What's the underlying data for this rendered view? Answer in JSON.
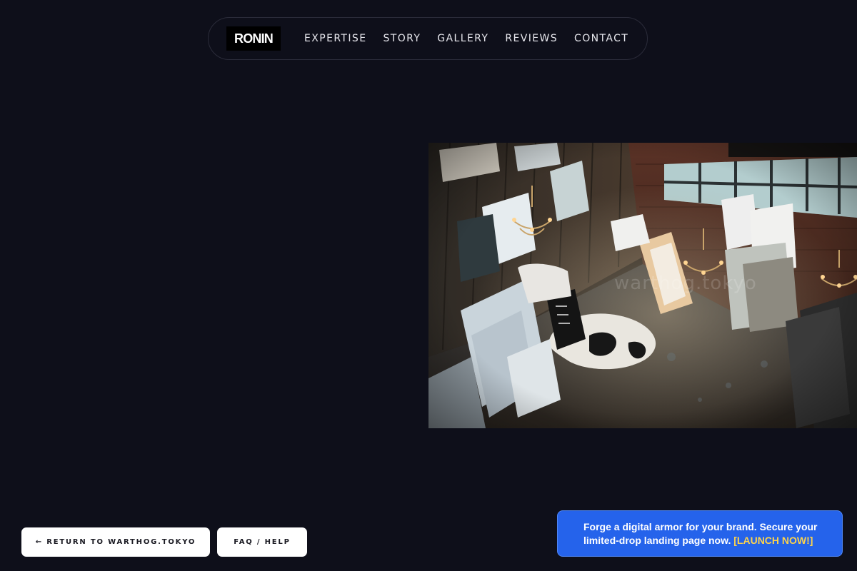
{
  "brand": {
    "logo": "RONIN"
  },
  "nav": {
    "items": [
      {
        "label": "EXPERTISE"
      },
      {
        "label": "STORY"
      },
      {
        "label": "GALLERY"
      },
      {
        "label": "REVIEWS"
      },
      {
        "label": "CONTACT"
      }
    ]
  },
  "hero": {
    "image_subject": "artist studio loft with stacked canvases, chandeliers and cowhide rug",
    "watermark": "warthog.tokyo"
  },
  "footer_buttons": {
    "return_label": "← RETURN TO WARTHOG.TOKYO",
    "faq_label": "FAQ / HELP"
  },
  "promo": {
    "text": "Forge a digital armor for your brand. Secure your limited-drop landing page now.",
    "cta": "[LAUNCH NOW!]"
  },
  "colors": {
    "background": "#0e0f1a",
    "promo_bg": "#2563eb",
    "promo_cta": "#fcd34d",
    "button_bg": "#ffffff"
  }
}
